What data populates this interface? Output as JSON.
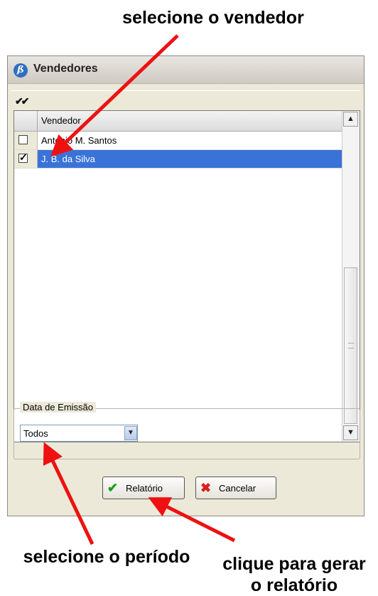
{
  "annotations": {
    "top": "selecione o vendedor",
    "left": "selecione o período",
    "right_line1": "clique para gerar",
    "right_line2": "o relatório"
  },
  "window": {
    "title": "Vendedores",
    "app_icon": "ß"
  },
  "toolbar": {
    "check_all_icon": "check-all-icon",
    "check_all_glyph": "✔✔"
  },
  "grid": {
    "column_header": "Vendedor",
    "rows": [
      {
        "name": "Antonio M. Santos",
        "checked": false,
        "selected": false
      },
      {
        "name": "J. B. da Silva",
        "checked": true,
        "selected": true
      }
    ]
  },
  "filter": {
    "group_label": "Data de Emissão",
    "select_value": "Todos"
  },
  "buttons": {
    "report_label": "Relatório",
    "cancel_label": "Cancelar"
  },
  "colors": {
    "selection": "#3a73d8",
    "arrow": "#ee1111",
    "window_bg": "#ece9d8"
  }
}
